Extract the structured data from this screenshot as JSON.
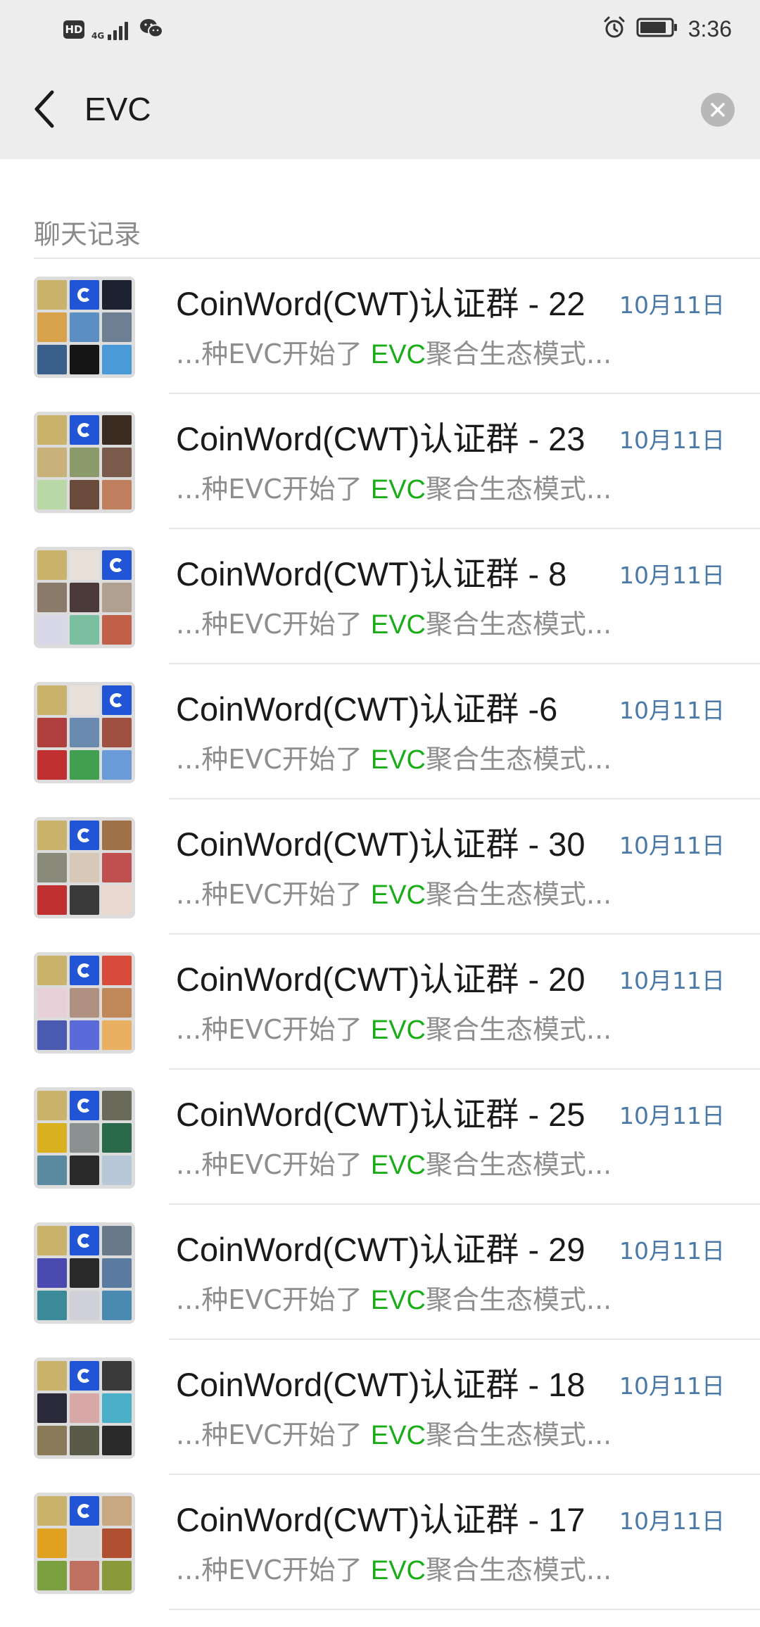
{
  "status_bar": {
    "left_icons": [
      "hd-icon",
      "signal-4g-icon",
      "wechat-icon"
    ],
    "hd_label": "HD",
    "network_label": "4G",
    "right_icons": [
      "alarm-icon",
      "battery-icon"
    ],
    "time": "3:36"
  },
  "search": {
    "query": "EVC",
    "back_icon": "chevron-left-icon",
    "clear_icon": "close-icon"
  },
  "section": {
    "label": "聊天记录"
  },
  "colors": {
    "highlight": "#1aad19",
    "date": "#4a79a8",
    "header_bg": "#ededed",
    "logo_blue": "#2255d6"
  },
  "results": [
    {
      "title": "CoinWord(CWT)认证群 - 22",
      "date": "10月11日",
      "snippet_pre": "...种EVC开始了 ",
      "snippet_hl": "EVC",
      "snippet_post": "聚合生态模式..."
    },
    {
      "title": "CoinWord(CWT)认证群 - 23",
      "date": "10月11日",
      "snippet_pre": "...种EVC开始了 ",
      "snippet_hl": "EVC",
      "snippet_post": "聚合生态模式..."
    },
    {
      "title": "CoinWord(CWT)认证群 - 8",
      "date": "10月11日",
      "snippet_pre": "...种EVC开始了 ",
      "snippet_hl": "EVC",
      "snippet_post": "聚合生态模式..."
    },
    {
      "title": "CoinWord(CWT)认证群 -6",
      "date": "10月11日",
      "snippet_pre": "...种EVC开始了 ",
      "snippet_hl": "EVC",
      "snippet_post": "聚合生态模式..."
    },
    {
      "title": "CoinWord(CWT)认证群 - 30",
      "date": "10月11日",
      "snippet_pre": "...种EVC开始了 ",
      "snippet_hl": "EVC",
      "snippet_post": "聚合生态模式..."
    },
    {
      "title": "CoinWord(CWT)认证群 - 20",
      "date": "10月11日",
      "snippet_pre": "...种EVC开始了 ",
      "snippet_hl": "EVC",
      "snippet_post": "聚合生态模式..."
    },
    {
      "title": "CoinWord(CWT)认证群 - 25",
      "date": "10月11日",
      "snippet_pre": "...种EVC开始了 ",
      "snippet_hl": "EVC",
      "snippet_post": "聚合生态模式..."
    },
    {
      "title": "CoinWord(CWT)认证群 - 29",
      "date": "10月11日",
      "snippet_pre": "...种EVC开始了 ",
      "snippet_hl": "EVC",
      "snippet_post": "聚合生态模式..."
    },
    {
      "title": "CoinWord(CWT)认证群 - 18",
      "date": "10月11日",
      "snippet_pre": "...种EVC开始了 ",
      "snippet_hl": "EVC",
      "snippet_post": "聚合生态模式..."
    },
    {
      "title": "CoinWord(CWT)认证群 - 17",
      "date": "10月11日",
      "snippet_pre": "...种EVC开始了 ",
      "snippet_hl": "EVC",
      "snippet_post": "聚合生态模式..."
    }
  ]
}
